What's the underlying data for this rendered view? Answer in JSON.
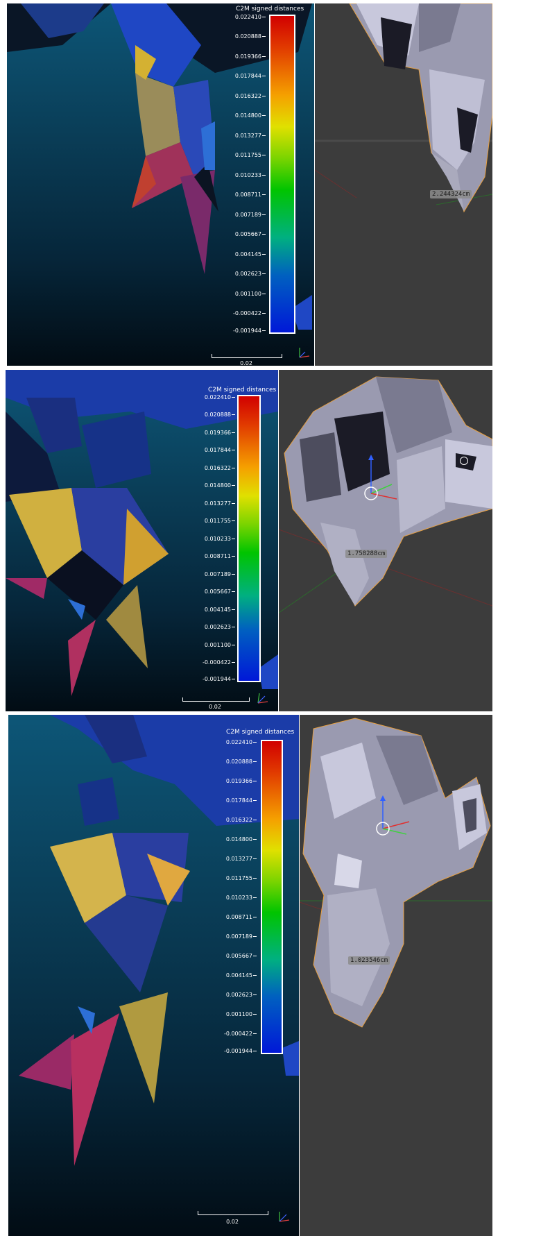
{
  "colorbar": {
    "title": "C2M signed distances",
    "ticks": [
      "0.022410",
      "0.020888",
      "0.019366",
      "0.017844",
      "0.016322",
      "0.014800",
      "0.013277",
      "0.011755",
      "0.010233",
      "0.008711",
      "0.007189",
      "0.005667",
      "0.004145",
      "0.002623",
      "0.001100",
      "-0.000422",
      "-0.001944"
    ]
  },
  "scale_label": "0.02",
  "measurements": [
    "2.244324cm",
    "1.758288cm",
    "1.023546cm"
  ]
}
